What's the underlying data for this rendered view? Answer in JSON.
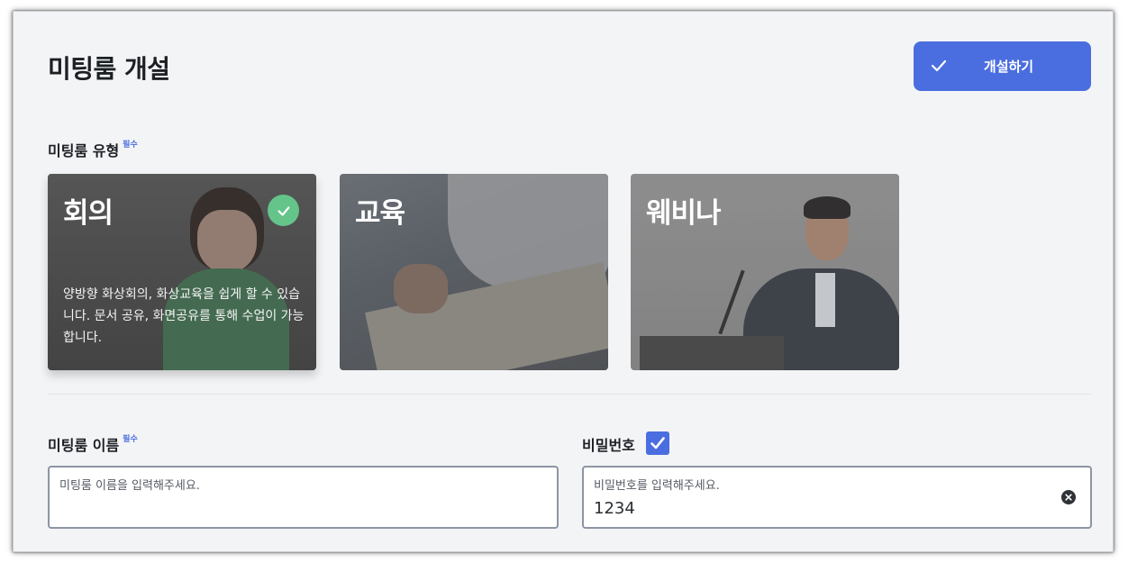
{
  "header": {
    "title": "미팅룸 개설",
    "create_button_label": "개설하기"
  },
  "room_type": {
    "label": "미팅룸 유형",
    "required_badge": "필수",
    "cards": [
      {
        "title": "회의",
        "selected": true,
        "description": "양방향 화상회의, 화상교육을 쉽게 할 수 있습니다. 문서 공유, 화면공유를 통해 수업이 가능합니다."
      },
      {
        "title": "교육",
        "selected": false
      },
      {
        "title": "웨비나",
        "selected": false
      }
    ]
  },
  "room_name": {
    "label": "미팅룸 이름",
    "required_badge": "필수",
    "placeholder": "미팅룸 이름을 입력해주세요.",
    "value": ""
  },
  "password": {
    "label": "비밀번호",
    "enabled": true,
    "placeholder": "비밀번호를 입력해주세요.",
    "value": "1234"
  },
  "colors": {
    "accent": "#4a6ee0",
    "selected_check": "#65c48a",
    "background": "#f3f4f6"
  },
  "icons": {
    "create_button": "check-icon",
    "selected_card": "check-circle-icon",
    "clear_input": "close-circle-icon",
    "password_toggle": "checkbox-checked-icon"
  }
}
